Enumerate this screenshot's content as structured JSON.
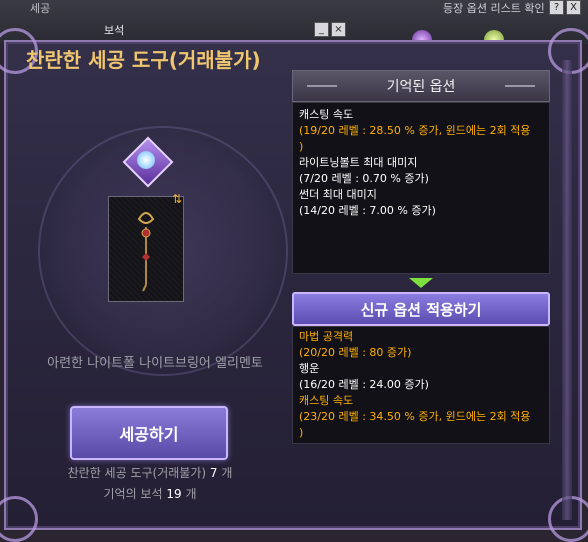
{
  "background": {
    "top_left_label": "세공",
    "gem_label": "보석",
    "right_label": "등장 옵션 리스트 확인",
    "help_button": "?",
    "close_button": "X"
  },
  "window": {
    "title": "찬란한 세공 도구(거래불가)",
    "item_name": "아련한 나이트폴 나이트브링어 엘리멘토",
    "refine_button": "세공하기",
    "tool_count_label": "찬란한 세공 도구(거래불가)",
    "tool_count": "7",
    "tool_count_unit": "개",
    "gem_count_label": "기억의 보석",
    "gem_count": "19",
    "gem_count_unit": "개"
  },
  "remembered": {
    "header": "기억된 옵션",
    "options": [
      {
        "name": "캐스팅 속도",
        "value": "(19/20 레벨 : 28.50 % 증가, 윈드에는 2회 적용",
        "value2": ")",
        "gold": true
      },
      {
        "name": "라이트닝볼트 최대 대미지",
        "value": "(7/20 레벨 : 0.70 % 증가)",
        "gold": false
      },
      {
        "name": "썬더 최대 대미지",
        "value": "(14/20 레벨 : 7.00 % 증가)",
        "gold": false
      }
    ]
  },
  "new_options": {
    "apply_button": "신규 옵션 적용하기",
    "options": [
      {
        "name": "마법 공격력",
        "value": "(20/20 레벨 : 80 증가)",
        "gold": true
      },
      {
        "name": "행운",
        "value": "(16/20 레벨 : 24.00 증가)",
        "gold": false
      },
      {
        "name": "캐스팅 속도",
        "value": "(23/20 레벨 : 34.50 % 증가, 윈드에는 2회 적용",
        "value2": ")",
        "gold": true
      }
    ]
  },
  "icons": [
    "gem-icon",
    "staff-item-icon",
    "swap-icon",
    "arrow-down-icon",
    "help-icon",
    "close-icon"
  ],
  "colors": {
    "title": "#f0c66e",
    "gold_text": "#ffb000",
    "button": "#6d5ec4",
    "arrow": "#7ee040"
  }
}
